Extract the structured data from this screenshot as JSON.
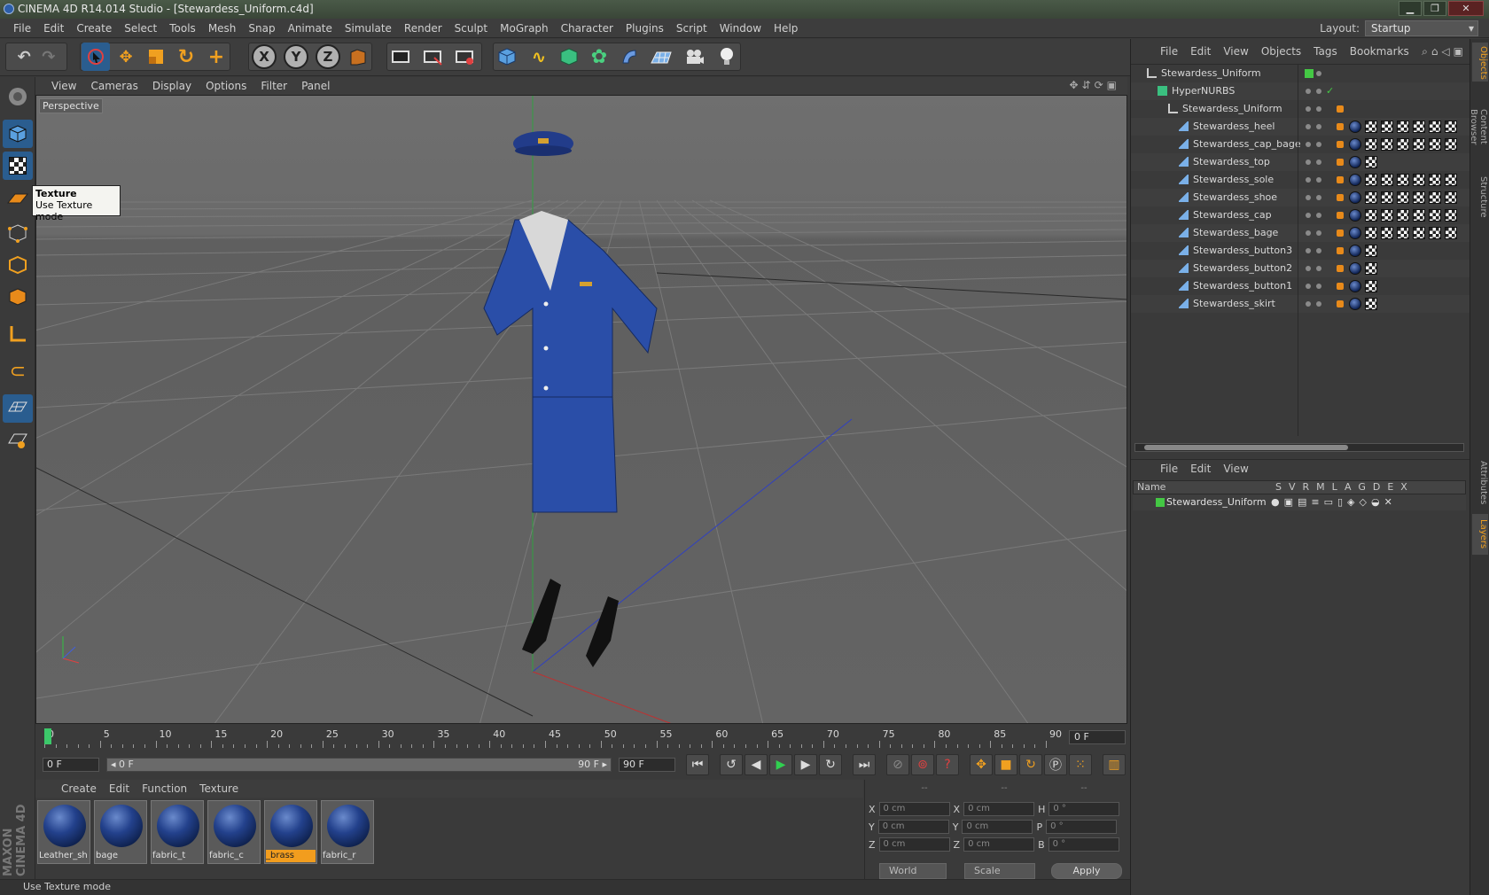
{
  "window": {
    "title": "CINEMA 4D R14.014 Studio - [Stewardess_Uniform.c4d]",
    "minimize": "▁",
    "maximize": "❐",
    "close": "✕"
  },
  "menubar": {
    "items": [
      "File",
      "Edit",
      "Create",
      "Select",
      "Tools",
      "Mesh",
      "Snap",
      "Animate",
      "Simulate",
      "Render",
      "Sculpt",
      "MoGraph",
      "Character",
      "Plugins",
      "Script",
      "Window",
      "Help"
    ],
    "layout_label": "Layout:",
    "layout_value": "Startup"
  },
  "toolbar": {
    "icons": [
      "undo-icon",
      "redo-icon",
      "live-selection-icon",
      "move-icon",
      "scale-icon",
      "rotate-icon",
      "add-object-icon",
      "x-axis-icon",
      "y-axis-icon",
      "z-axis-icon",
      "coordinate-system-icon",
      "render-view-icon",
      "render-picture-icon",
      "render-settings-icon",
      "cube-icon",
      "spline-icon",
      "nurbs-icon",
      "array-icon",
      "deformer-icon",
      "floor-icon",
      "camera-icon",
      "light-icon"
    ],
    "axis_x": "X",
    "axis_y": "Y",
    "axis_z": "Z"
  },
  "viewport": {
    "menu": [
      "View",
      "Cameras",
      "Display",
      "Options",
      "Filter",
      "Panel"
    ],
    "label": "Perspective"
  },
  "tooltip": {
    "title": "Texture",
    "text": "Use Texture mode"
  },
  "timeline": {
    "ticks": [
      "0",
      "5",
      "10",
      "15",
      "20",
      "25",
      "30",
      "35",
      "40",
      "45",
      "50",
      "55",
      "60",
      "65",
      "70",
      "75",
      "80",
      "85",
      "90"
    ],
    "current_frame": "0 F"
  },
  "playback": {
    "start_frame": "0 F",
    "range_start": "◂ 0 F",
    "range_end": "90 F ▸",
    "end_frame": "90 F"
  },
  "materials": {
    "menu": [
      "Create",
      "Edit",
      "Function",
      "Texture"
    ],
    "items": [
      {
        "name": "Leather_sh",
        "selected": false
      },
      {
        "name": "bage",
        "selected": false
      },
      {
        "name": "fabric_t",
        "selected": false
      },
      {
        "name": "fabric_c",
        "selected": false
      },
      {
        "name": "_brass",
        "selected": true
      },
      {
        "name": "fabric_r",
        "selected": false
      }
    ]
  },
  "coords": {
    "header": [
      "--",
      "--",
      "--"
    ],
    "rows": [
      {
        "a": "X",
        "av": "0 cm",
        "b": "X",
        "bv": "0 cm",
        "c": "H",
        "cv": "0 °"
      },
      {
        "a": "Y",
        "av": "0 cm",
        "b": "Y",
        "bv": "0 cm",
        "c": "P",
        "cv": "0 °"
      },
      {
        "a": "Z",
        "av": "0 cm",
        "b": "Z",
        "bv": "0 cm",
        "c": "B",
        "cv": "0 °"
      }
    ],
    "mode1": "World",
    "mode2": "Scale",
    "apply": "Apply"
  },
  "status": {
    "text": "Use Texture mode",
    "logo_text": "MAXON CINEMA 4D"
  },
  "objects": {
    "menu": [
      "File",
      "Edit",
      "View",
      "Objects",
      "Tags",
      "Bookmarks"
    ],
    "rows": [
      {
        "name": "Stewardess_Uniform",
        "level": 0
      },
      {
        "name": "HyperNURBS",
        "level": 1
      },
      {
        "name": "Stewardess_Uniform",
        "level": 2
      },
      {
        "name": "Stewardess_heel",
        "level": 3
      },
      {
        "name": "Stewardess_cap_bage",
        "level": 3
      },
      {
        "name": "Stewardess_top",
        "level": 3
      },
      {
        "name": "Stewardess_sole",
        "level": 3
      },
      {
        "name": "Stewardess_shoe",
        "level": 3
      },
      {
        "name": "Stewardess_cap",
        "level": 3
      },
      {
        "name": "Stewardess_bage",
        "level": 3
      },
      {
        "name": "Stewardess_button3",
        "level": 3
      },
      {
        "name": "Stewardess_button2",
        "level": 3
      },
      {
        "name": "Stewardess_button1",
        "level": 3
      },
      {
        "name": "Stewardess_skirt",
        "level": 3
      }
    ]
  },
  "layers": {
    "menu": [
      "File",
      "Edit",
      "View"
    ],
    "header_name": "Name",
    "header_cols": "SVRMLAGDEX",
    "row_name": "Stewardess_Uniform"
  },
  "side_tabs": [
    "Objects",
    "Content Browser",
    "Structure",
    "Attributes",
    "Layers"
  ],
  "colors": {
    "accent": "#2a5d8f",
    "selection": "#f29d1e",
    "layer_green": "#44c844"
  }
}
